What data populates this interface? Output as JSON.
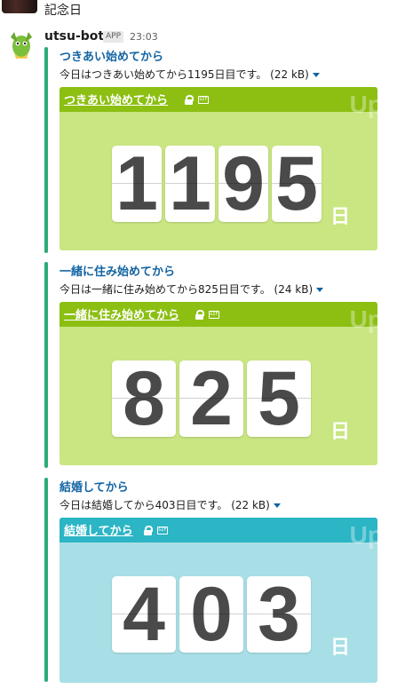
{
  "channel_title": "記念日",
  "message": {
    "bot_name": "utsu-bot",
    "badge": "APP",
    "time": "23:03"
  },
  "posts": [
    {
      "title": "つきあい始めてから",
      "text": "今日はつきあい始めてから1195日目です。",
      "size": "(22 kB)",
      "card_title": "つきあい始めてから",
      "watermark": "Up",
      "digits": [
        "1",
        "1",
        "9",
        "5"
      ],
      "day_unit": "日",
      "colors": {
        "header": "#8cbf12",
        "body": "#c9e682"
      }
    },
    {
      "title": "一緒に住み始めてから",
      "text": "今日は一緒に住み始めてから825日目です。",
      "size": "(24 kB)",
      "card_title": "一緒に住み始めてから",
      "watermark": "Up",
      "digits": [
        "8",
        "2",
        "5"
      ],
      "day_unit": "日",
      "colors": {
        "header": "#8cbf12",
        "body": "#c9e682"
      }
    },
    {
      "title": "結婚してから",
      "text": "今日は結婚してから403日目です。",
      "size": "(22 kB)",
      "card_title": "結婚してから",
      "watermark": "Up",
      "digits": [
        "4",
        "0",
        "3"
      ],
      "day_unit": "日",
      "colors": {
        "header": "#2cb5c4",
        "body": "#a8dfe6"
      }
    }
  ],
  "accent_bar_color": "#2bac76",
  "link_color": "#1264a3"
}
